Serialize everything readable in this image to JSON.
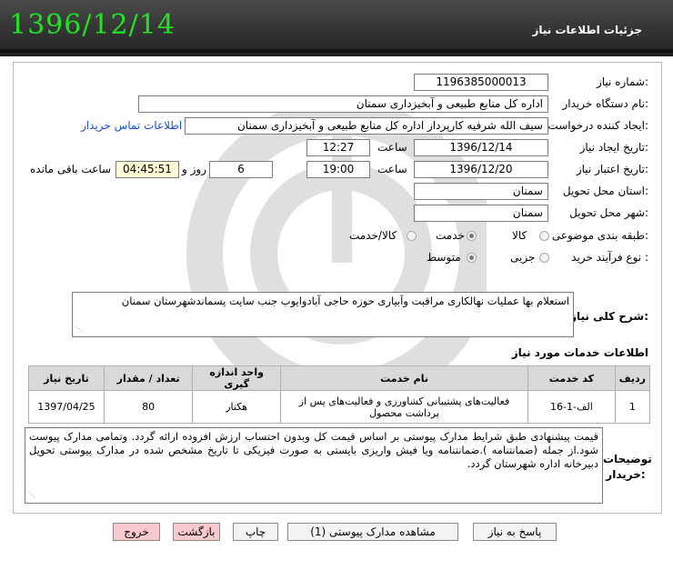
{
  "header": {
    "date": "1396/12/14",
    "title": "جزئیات اطلاعات نیاز"
  },
  "fields": {
    "need_number_label": "شماره نیاز:",
    "need_number": "1196385000013",
    "buyer_label": "نام دستگاه خریدار:",
    "buyer": "اداره کل منابع طبیعی و آبخیزداری سمنان",
    "creator_label": "ایجاد کننده درخواست:",
    "creator": "سیف الله شرفیه کارپرداز اداره کل منابع طبیعی و آبخیزداری سمنان",
    "contact_link": "اطلاعات تماس خریدار",
    "created_date_label": "تاریخ ایجاد نیاز:",
    "created_date": "1396/12/14",
    "time_label": "ساعت",
    "created_time": "12:27",
    "validity_label": "تاریخ اعتبار نیاز:",
    "validity_date": "1396/12/20",
    "validity_time": "19:00",
    "days": "6",
    "day_label": "روز و",
    "remaining_time": "04:45:51",
    "remaining_label": "ساعت باقی مانده",
    "province_label": "استان محل تحویل:",
    "province": "سمنان",
    "city_label": "شهر محل تحویل:",
    "city": "سمنان",
    "category_label": "طبقه بندی موضوعی:",
    "category_options": [
      "کالا",
      "خدمت",
      "کالا/خدمت"
    ],
    "process_label": "نوع فرآیند خرید :",
    "process_options": [
      "جزیی",
      "متوسط"
    ]
  },
  "summary": {
    "label": "شرح کلی نیاز:",
    "text": "استعلام بها عملیات نهالکاری مراقبت وآبیاری حوزه حاجی آبادوایوب جنب سایت پسماندشهرستان سمنان"
  },
  "services": {
    "title": "اطلاعات خدمات مورد نیاز",
    "headers": [
      "ردیف",
      "کد خدمت",
      "نام خدمت",
      "واحد اندازه گیری",
      "تعداد / مقدار",
      "تاریخ نیاز"
    ],
    "rows": [
      {
        "row": "1",
        "code": "الف-1-16",
        "name": "فعالیت‌های پشتیبانی کشاورزی و فعالیت‌های پس از برداشت محصول",
        "unit": "هکتار",
        "qty": "80",
        "date": "1397/04/25"
      }
    ]
  },
  "notes": {
    "label": "توضیحات خریدار:",
    "text": "قیمت پیشنهادی طبق شرایط مدارک پیوستی بر اساس قیمت کل وبدون احتساب ارزش افزوده ارائه گردد. وتمامی مدارک پیوست شود.از جمله (ضمانتنامه ).ضمانتنامه ویا فیش واریزی بایستی به صورت فیزیکی تا تاریخ مشخص شده در مدارک پیوستی تحویل دبیرخانه اداره شهرستان گردد."
  },
  "buttons": {
    "reply": "پاسخ به نیاز",
    "attachments": "مشاهده مدارک پیوستی (1)",
    "print": "چاپ",
    "back": "بازگشت",
    "exit": "خروج"
  }
}
